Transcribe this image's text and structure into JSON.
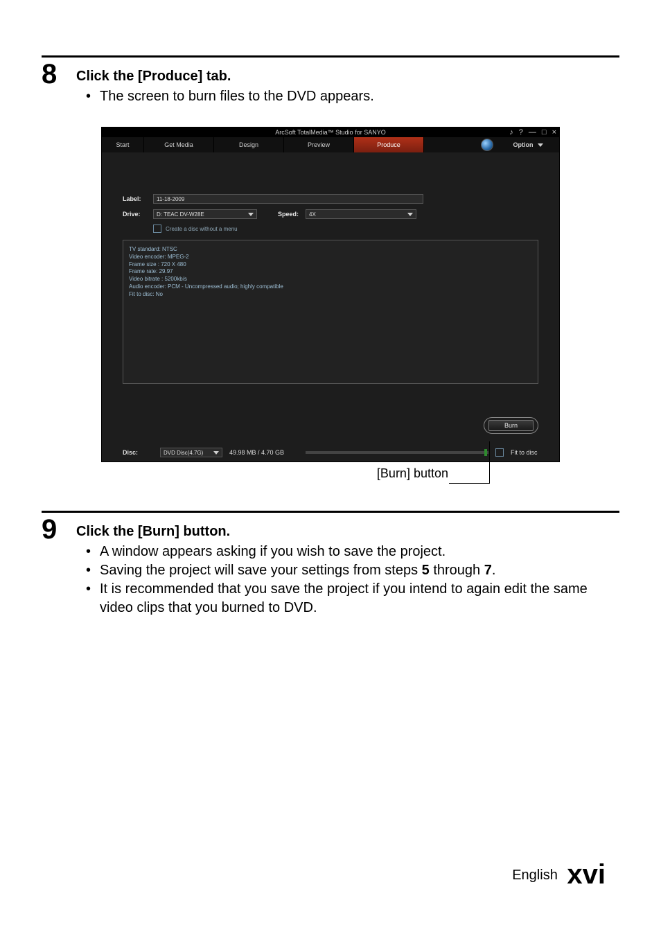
{
  "step8": {
    "num": "8",
    "title": "Click the [Produce] tab.",
    "bullets": [
      "The screen to burn files to the DVD appears."
    ]
  },
  "callout": {
    "burn_label": "[Burn] button"
  },
  "step9": {
    "num": "9",
    "title": "Click the [Burn] button.",
    "bullets": [
      "A window appears asking if you wish to save the project.",
      "Saving the project will save your settings from steps 5 through 7.",
      "It is recommended that you save the project if you intend to again edit the same video clips that you burned to DVD."
    ]
  },
  "footer": {
    "lang": "English",
    "page": "xvi"
  },
  "shot": {
    "title": "ArcSoft TotalMedia™ Studio for SANYO",
    "winicons": {
      "music": "♪",
      "help": "?",
      "min": "—",
      "max": "□",
      "close": "×"
    },
    "tabs": {
      "start": "Start",
      "get_media": "Get Media",
      "design": "Design",
      "preview": "Preview",
      "produce": "Produce",
      "option": "Option"
    },
    "form": {
      "label_lbl": "Label:",
      "label_val": "11-18-2009",
      "drive_lbl": "Drive:",
      "drive_val": "D: TEAC DV-W28E",
      "speed_lbl": "Speed:",
      "speed_val": "4X",
      "checkbox": "Create a disc without a menu"
    },
    "info": [
      "TV standard: NTSC",
      "Video encoder: MPEG-2",
      "Frame size : 720 X 480",
      "Frame rate: 29.97",
      "Video bitrate : 5200kb/s",
      "Audio encoder: PCM - Uncompressed audio; highly compatible",
      "Fit to disc: No"
    ],
    "burn_btn": "Burn",
    "status": {
      "disc_lbl": "Disc:",
      "disc_val": "DVD Disc(4.7G)",
      "size": "49.98 MB / 4.70 GB",
      "fit": "Fit to disc"
    }
  }
}
